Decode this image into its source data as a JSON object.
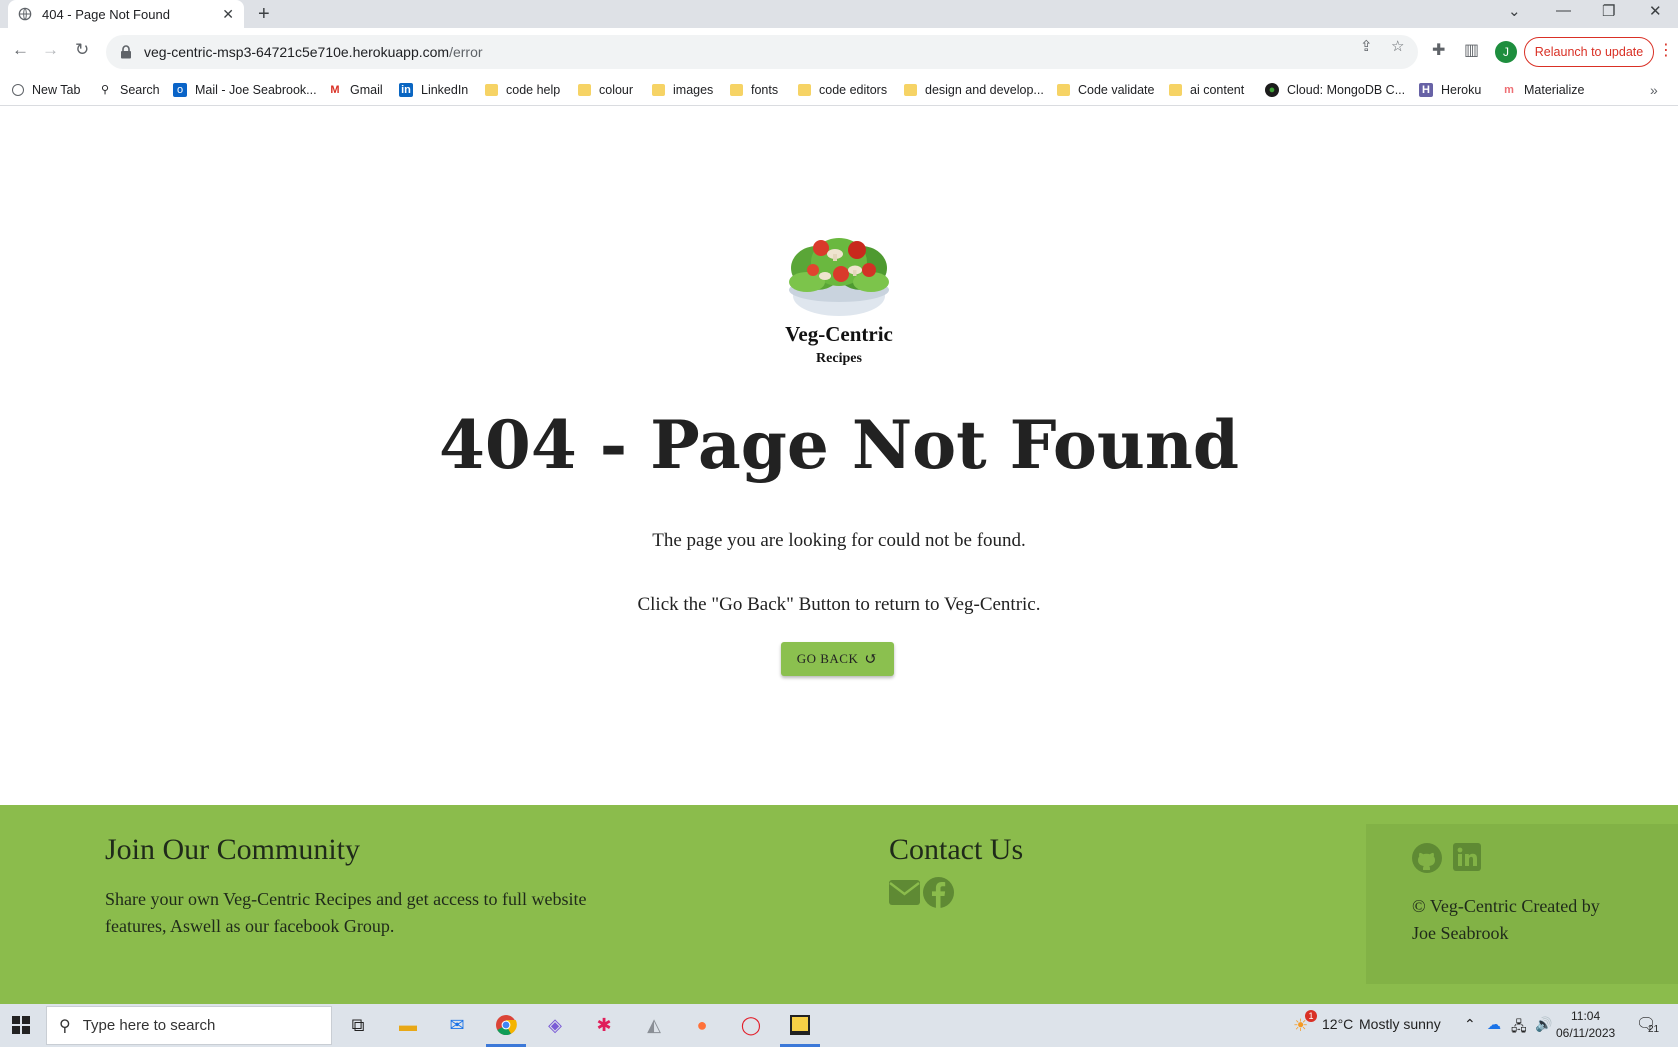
{
  "browser": {
    "tab_title": "404 - Page Not Found",
    "url_host": "veg-centric-msp3-64721c5e710e.herokuapp.com",
    "url_path": "/error",
    "relaunch_label": "Relaunch to update",
    "profile_initial": "J",
    "bookmarks": [
      {
        "label": "New Tab",
        "icon": "globe-icon"
      },
      {
        "label": "Search",
        "icon": "search-icon"
      },
      {
        "label": "Mail - Joe Seabrook...",
        "icon": "outlook-icon"
      },
      {
        "label": "Gmail",
        "icon": "gmail-icon"
      },
      {
        "label": "LinkedIn",
        "icon": "linkedin-icon"
      },
      {
        "label": "code help",
        "icon": "folder-icon"
      },
      {
        "label": "colour",
        "icon": "folder-icon"
      },
      {
        "label": "images",
        "icon": "folder-icon"
      },
      {
        "label": "fonts",
        "icon": "folder-icon"
      },
      {
        "label": "code editors",
        "icon": "folder-icon"
      },
      {
        "label": "design and develop...",
        "icon": "folder-icon"
      },
      {
        "label": "Code validate",
        "icon": "folder-icon"
      },
      {
        "label": "ai content",
        "icon": "folder-icon"
      },
      {
        "label": "Cloud: MongoDB C...",
        "icon": "mongodb-icon"
      },
      {
        "label": "Heroku",
        "icon": "heroku-icon"
      },
      {
        "label": "Materialize",
        "icon": "materialize-icon"
      }
    ]
  },
  "page": {
    "brand_name": "Veg-Centric",
    "brand_sub": "Recipes",
    "heading": "404 - Page Not Found",
    "message_1": "The page you are looking for could not be found.",
    "message_2": "Click the \"Go Back\" Button to return to Veg-Centric.",
    "go_back_label": "GO BACK"
  },
  "footer": {
    "community_title": "Join Our Community",
    "community_text_1": "Share your own Veg-Centric Recipes and get access to full website",
    "community_text_2": "features, Aswell as our facebook Group.",
    "contact_title": "Contact Us",
    "copyright_1": "© Veg-Centric Created by",
    "copyright_2": "Joe Seabrook",
    "colors": {
      "footer_bg": "#8bbc4c",
      "button_bg": "#8bc04f"
    }
  },
  "taskbar": {
    "search_placeholder": "Type here to search",
    "weather_temp": "12°C",
    "weather_desc": "Mostly sunny",
    "weather_badge": "1",
    "time": "11:04",
    "date": "06/11/2023",
    "notification_count": "21"
  }
}
